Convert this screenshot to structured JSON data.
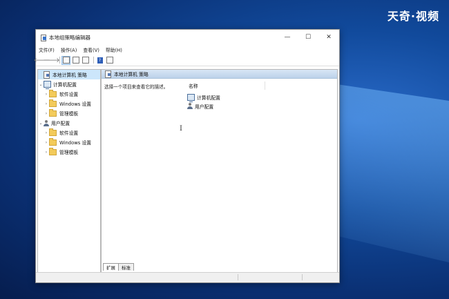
{
  "watermark": "天奇·视频",
  "window": {
    "title": "本地组策略编辑器",
    "controls": {
      "minimize": "—",
      "maximize": "☐",
      "close": "✕"
    }
  },
  "menu": [
    "文件(F)",
    "操作(A)",
    "查看(V)",
    "帮助(H)"
  ],
  "toolbar": {
    "icons": [
      "back-arrow-icon",
      "forward-arrow-icon",
      "show-tree-icon",
      "export-list-icon",
      "properties-icon",
      "help-icon",
      "view-icon"
    ],
    "help_label": "?"
  },
  "tree": {
    "root": "本地计算机 策略",
    "computer_config": "计算机配置",
    "computer_children": [
      "软件设置",
      "Windows 设置",
      "管理模板"
    ],
    "user_config": "用户配置",
    "user_children": [
      "软件设置",
      "Windows 设置",
      "管理模板"
    ]
  },
  "detail": {
    "header": "本地计算机 策略",
    "description": "选择一个项目来查看它的描述。",
    "column_name": "名称",
    "items": [
      "计算机配置",
      "用户配置"
    ]
  },
  "tabs": [
    "扩展",
    "标准"
  ]
}
